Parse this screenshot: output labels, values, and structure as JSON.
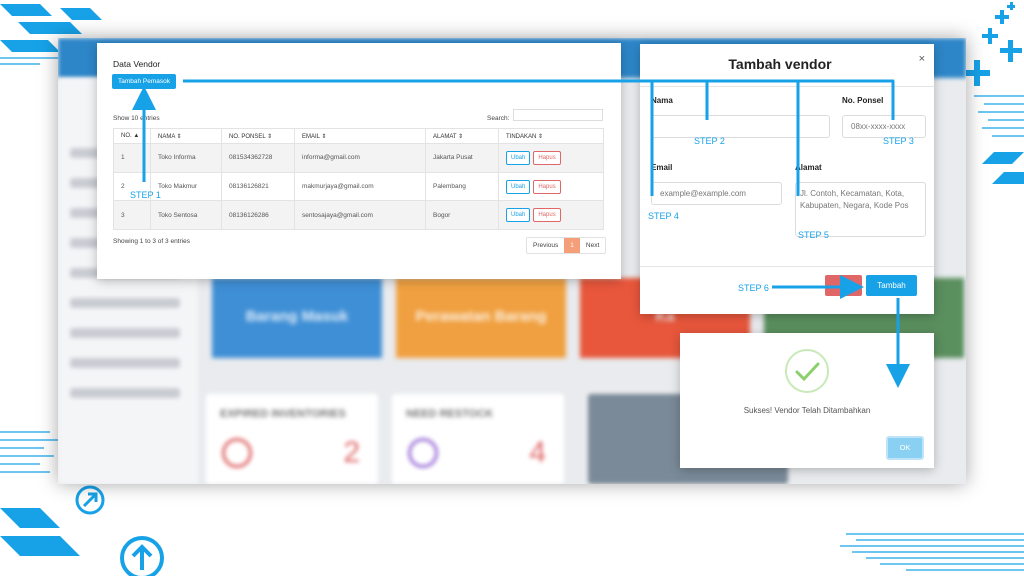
{
  "colors": {
    "accent": "#17a2e8",
    "danger": "#e06767",
    "success": "#8ccf6d",
    "page_active": "#f59e7a"
  },
  "background": {
    "tiles": [
      {
        "label": "Barang Masuk",
        "color": "#3f8fd6"
      },
      {
        "label": "Perawatan Barang",
        "color": "#f0a040"
      },
      {
        "label": "Ka",
        "color": "#e8573c"
      }
    ],
    "cards": [
      {
        "title": "EXPIRED INVENTORIES",
        "value": "2"
      },
      {
        "title": "NEED RESTOCK",
        "value": "4"
      }
    ]
  },
  "vendor_panel": {
    "title": "Data Vendor",
    "add_button": "Tambah Pemasok",
    "show_label": "Show",
    "entries_label": "entries",
    "search_label": "Search:",
    "columns": [
      "NO.",
      "NAMA",
      "NO. PONSEL",
      "EMAIL",
      "ALAMAT",
      "TINDAKAN"
    ],
    "rows": [
      {
        "no": "1",
        "nama": "Toko Informa",
        "ponsel": "081534362728",
        "email": "informa@gmail.com",
        "alamat": "Jakarta Pusat"
      },
      {
        "no": "2",
        "nama": "Toko Makmur",
        "ponsel": "08136126821",
        "email": "makmurjaya@gmail.com",
        "alamat": "Palembang"
      },
      {
        "no": "3",
        "nama": "Toko Sentosa",
        "ponsel": "08136126286",
        "email": "sentosajaya@gmail.com",
        "alamat": "Bogor"
      }
    ],
    "edit_label": "Ubah",
    "delete_label": "Hapus",
    "info": "Showing 1 to 3 of 3 entries",
    "pagination": {
      "prev": "Previous",
      "current": "1",
      "next": "Next"
    }
  },
  "modal": {
    "title": "Tambah vendor",
    "close": "×",
    "nama_label": "Nama",
    "ponsel_label": "No. Ponsel",
    "ponsel_placeholder": "08xx-xxxx-xxxx",
    "email_label": "Email",
    "email_placeholder": "example@example.com",
    "alamat_label": "Alamat",
    "alamat_placeholder": "Jl. Contoh, Kecamatan, Kota, Kabupaten, Negara, Kode Pos",
    "submit": "Tambah"
  },
  "alert": {
    "message": "Sukses! Vendor Telah Ditambahkan",
    "ok": "OK"
  },
  "steps": [
    "STEP 1",
    "STEP 2",
    "STEP 3",
    "STEP 4",
    "STEP 5",
    "STEP 6"
  ]
}
